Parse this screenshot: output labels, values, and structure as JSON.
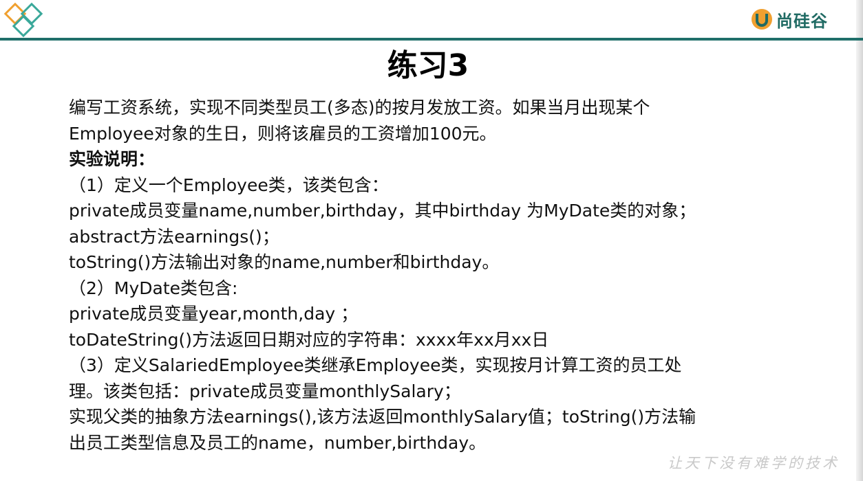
{
  "brand": {
    "name": "尚硅谷"
  },
  "slide": {
    "title": "练习3",
    "lines": [
      "编写工资系统，实现不同类型员工(多态)的按月发放工资。如果当月出现某个",
      "Employee对象的生日，则将该雇员的工资增加100元。",
      "实验说明：",
      "（1）定义一个Employee类，该类包含：",
      "private成员变量name,number,birthday，其中birthday 为MyDate类的对象；",
      "abstract方法earnings()；",
      "toString()方法输出对象的name,number和birthday。",
      "（2）MyDate类包含:",
      "private成员变量year,month,day ；",
      "toDateString()方法返回日期对应的字符串：xxxx年xx月xx日",
      "（3）定义SalariedEmployee类继承Employee类，实现按月计算工资的员工处",
      "理。该类包括：private成员变量monthlySalary；",
      "实现父类的抽象方法earnings(),该方法返回monthlySalary值；toString()方法输",
      "出员工类型信息及员工的name，number,birthday。"
    ]
  },
  "watermark": "让天下没有难学的技术",
  "colors": {
    "accent": "#1f6f6a",
    "brand_orange": "#f0a030",
    "text": "#111111",
    "watermark": "#c9c9c9"
  }
}
